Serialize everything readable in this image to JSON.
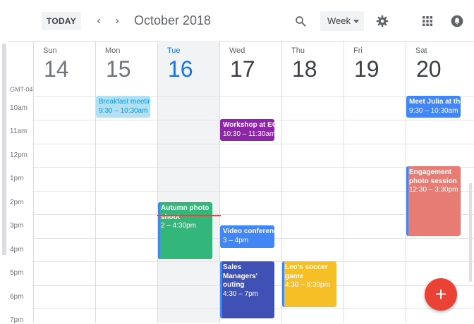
{
  "header": {
    "today_label": "TODAY",
    "month_title": "October 2018",
    "view_label": "Week",
    "icons": [
      "chevron-left-icon",
      "chevron-right-icon",
      "search-icon",
      "gear-icon",
      "apps-grid-icon",
      "notifications-icon"
    ]
  },
  "timezone": "GMT-04",
  "days": [
    {
      "name": "Sun",
      "date": "14",
      "state": "past"
    },
    {
      "name": "Mon",
      "date": "15",
      "state": "past"
    },
    {
      "name": "Tue",
      "date": "16",
      "state": "today"
    },
    {
      "name": "Wed",
      "date": "17",
      "state": "future"
    },
    {
      "name": "Thu",
      "date": "18",
      "state": "future"
    },
    {
      "name": "Fri",
      "date": "19",
      "state": "future"
    },
    {
      "name": "Sat",
      "date": "20",
      "state": "future"
    }
  ],
  "times": [
    "10am",
    "11am",
    "12pm",
    "1pm",
    "2pm",
    "3pm",
    "4pm",
    "5pm",
    "6pm",
    "7pm"
  ],
  "events": [
    {
      "title": "Breakfast meeting",
      "time": "9:30 – 10:30am",
      "day": "Mon",
      "color": "#b3e0f2"
    },
    {
      "title": "Workshop at EC",
      "time": "10:30 – 11:30am",
      "day": "Wed",
      "color": "#8e24aa"
    },
    {
      "title": "Meet Julia at the",
      "time": "9:30 – 10:30am",
      "day": "Sat",
      "color": "#4285f4"
    },
    {
      "title": "Engagement\nphoto session",
      "time": "12:30 – 3:30pm",
      "day": "Sat",
      "color": "#e67c73"
    },
    {
      "title": "Autumn photo\nshoot",
      "time": "2 – 4:30pm",
      "day": "Tue",
      "color": "#33b679"
    },
    {
      "title": "Video conference",
      "time": "3 – 4pm",
      "day": "Wed",
      "color": "#4285f4"
    },
    {
      "title": "Sales\nManagers'\nouting",
      "time": "4:30 – 7pm",
      "day": "Wed",
      "color": "#3f51b5"
    },
    {
      "title": "Leo's soccer\ngame",
      "time": "4:30 – 6:30pm",
      "day": "Thu",
      "color": "#f6bf26"
    }
  ],
  "fab_label": "+",
  "colors": {
    "accent": "#1a73e8",
    "now_line": "#ea4335",
    "fab": "#ea4335"
  }
}
